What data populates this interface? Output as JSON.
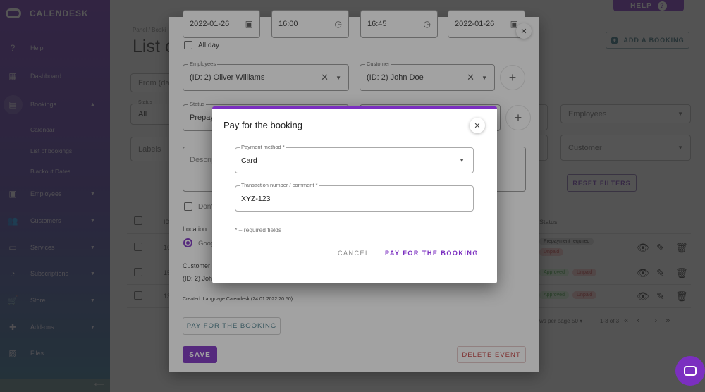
{
  "app": {
    "name": "CALENDESK"
  },
  "sidebar": {
    "items": [
      {
        "label": "Help",
        "icon": "help-circle-icon"
      },
      {
        "label": "Dashboard",
        "icon": "dashboard-icon"
      },
      {
        "label": "Bookings",
        "icon": "calendar-icon",
        "expanded": true
      },
      {
        "label": "Employees",
        "icon": "badge-icon"
      },
      {
        "label": "Customers",
        "icon": "people-icon"
      },
      {
        "label": "Services",
        "icon": "store-icon"
      },
      {
        "label": "Subscriptions",
        "icon": "subscription-icon"
      },
      {
        "label": "Store",
        "icon": "cart-icon"
      },
      {
        "label": "Add-ons",
        "icon": "puzzle-icon"
      },
      {
        "label": "Files",
        "icon": "image-icon"
      }
    ],
    "bookings_sub": [
      "Calendar",
      "List of bookings",
      "Blackout Dates"
    ]
  },
  "header": {
    "help_label": "HELP",
    "breadcrumb": "Panel / Booki",
    "title": "List o",
    "add_booking_label": "ADD A BOOKING"
  },
  "filters": {
    "from_day": "From (day",
    "status_label": "Status",
    "status_value": "All",
    "labels_placeholder": "Labels",
    "employees_placeholder": "Employees",
    "customer_placeholder": "Customer",
    "reset_label": "RESET FILTERS"
  },
  "table": {
    "id_header": "ID",
    "status_header": "Status",
    "rows": [
      {
        "id": "16",
        "chips": [
          {
            "text": "Prepayment required",
            "kind": "gray"
          },
          {
            "text": "Unpaid",
            "kind": "red"
          }
        ]
      },
      {
        "id": "15",
        "chips": [
          {
            "text": "Approved",
            "kind": "green"
          },
          {
            "text": "Unpaid",
            "kind": "red"
          }
        ]
      },
      {
        "id": "13",
        "chips": [
          {
            "text": "Approved",
            "kind": "green"
          },
          {
            "text": "Unpaid",
            "kind": "red"
          }
        ]
      }
    ],
    "rows_per_page_label": "ws per page",
    "rows_per_page_value": "50",
    "range": "1-3 of 3"
  },
  "booking_modal": {
    "start_date": "2022-01-26",
    "start_time": "16:00",
    "end_time": "16:45",
    "end_date": "2022-01-26",
    "all_day_label": "All day",
    "employees_label": "Employees",
    "employees_value": "(ID: 2) Oliver Williams",
    "customer_label": "Customer",
    "customer_value": "(ID: 2) John Doe",
    "status_label": "Status",
    "status_value": "Prepay",
    "description_placeholder": "Descrip",
    "dont_label": "Don'",
    "location_label": "Location:",
    "location_value": "Goog",
    "customer_heading": "Customer",
    "customer_line": "(ID: 2) Joh",
    "created": "Created: Language Calendesk (24.01.2022 20:50)",
    "pay_button": "PAY FOR THE BOOKING",
    "save_button": "SAVE",
    "delete_button": "DELETE EVENT"
  },
  "pay_dialog": {
    "title": "Pay for the booking",
    "payment_method_label": "Payment method *",
    "payment_method_value": "Card",
    "transaction_label": "Transaction number / comment *",
    "transaction_value": "XYZ-123",
    "required_note": "* – required fields",
    "cancel_label": "CANCEL",
    "confirm_label": "PAY FOR THE BOOKING"
  },
  "colors": {
    "brand": "#7b2fc0",
    "danger": "#c23b3b",
    "success": "#3a9a3a"
  }
}
